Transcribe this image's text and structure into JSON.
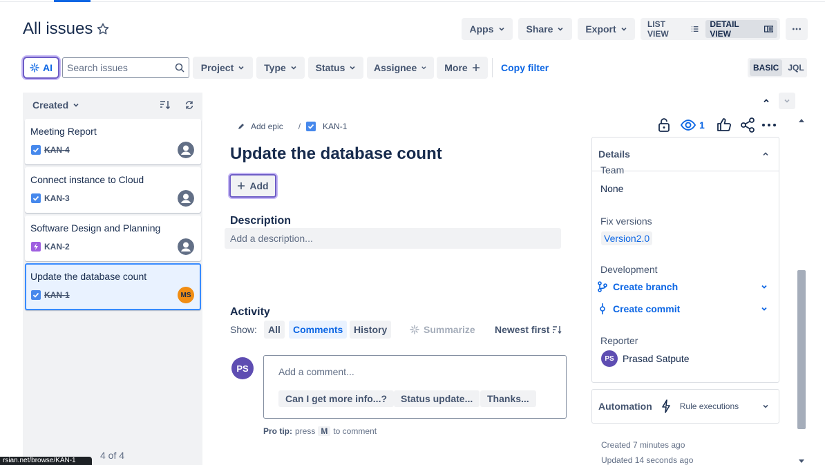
{
  "header": {
    "title": "All issues",
    "apps": "Apps",
    "share": "Share",
    "export": "Export",
    "list_view": "LIST VIEW",
    "detail_view": "DETAIL VIEW"
  },
  "filters": {
    "ai": "AI",
    "search_placeholder": "Search issues",
    "project": "Project",
    "type": "Type",
    "status": "Status",
    "assignee": "Assignee",
    "more": "More",
    "copy_filter": "Copy filter",
    "basic": "BASIC",
    "jql": "JQL"
  },
  "list": {
    "sort": "Created",
    "count": "4 of 4",
    "items": [
      {
        "title": "Meeting Report",
        "key": "KAN-4",
        "done": true,
        "type": "task"
      },
      {
        "title": "Connect instance to Cloud",
        "key": "KAN-3",
        "done": false,
        "type": "task"
      },
      {
        "title": "Software Design and Planning",
        "key": "KAN-2",
        "done": false,
        "type": "epic"
      },
      {
        "title": "Update the database count",
        "key": "KAN-1",
        "done": true,
        "type": "task",
        "assignee": "MS"
      }
    ]
  },
  "status_url": "rsian.net/browse/KAN-1",
  "issue": {
    "add_epic": "Add epic",
    "key": "KAN-1",
    "title": "Update the database count",
    "add": "Add",
    "watchers": "1",
    "description_label": "Description",
    "description_placeholder": "Add a description...",
    "activity_label": "Activity",
    "show": "Show:",
    "tabs": [
      "All",
      "Comments",
      "History"
    ],
    "summarize": "Summarize",
    "newest_first": "Newest first",
    "commenter_initials": "PS",
    "comment_placeholder": "Add a comment...",
    "quick_replies": [
      "Can I get more info...?",
      "Status update...",
      "Thanks..."
    ],
    "pro_tip_label": "Pro tip:",
    "pro_tip_press": "press",
    "pro_tip_key": "M",
    "pro_tip_rest": "to comment"
  },
  "details": {
    "heading": "Details",
    "team_label": "Team",
    "team_value": "None",
    "fix_versions_label": "Fix versions",
    "fix_versions_value": "Version2.0",
    "development_label": "Development",
    "create_branch": "Create branch",
    "create_commit": "Create commit",
    "reporter_label": "Reporter",
    "reporter_initials": "PS",
    "reporter_name": "Prasad Satpute"
  },
  "automation": {
    "label": "Automation",
    "rule_executions": "Rule executions"
  },
  "meta": {
    "created": "Created 7 minutes ago",
    "updated": "Updated 14 seconds ago"
  },
  "colors": {
    "accent": "#0c66e4",
    "ai_border": "#6e5dc6",
    "task_check": "#4688ec",
    "epic": "#9f5fe0",
    "assignee_ms": "#f18d13",
    "avatar_ps": "#5e4db2"
  }
}
